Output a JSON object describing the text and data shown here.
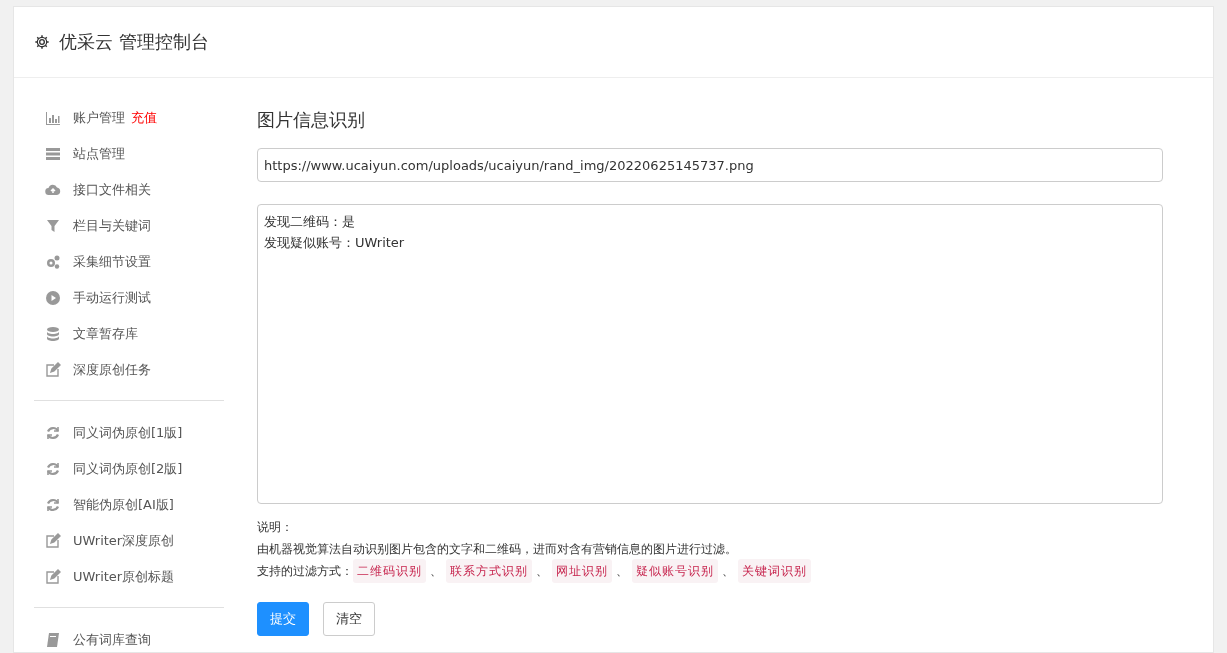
{
  "header": {
    "title": "优采云 管理控制台"
  },
  "sidebar": {
    "groups": [
      {
        "items": [
          {
            "label": "账户管理",
            "badge": "充值"
          },
          {
            "label": "站点管理"
          },
          {
            "label": "接口文件相关"
          },
          {
            "label": "栏目与关键词"
          },
          {
            "label": "采集细节设置"
          },
          {
            "label": "手动运行测试"
          },
          {
            "label": "文章暂存库"
          },
          {
            "label": "深度原创任务"
          }
        ]
      },
      {
        "items": [
          {
            "label": "同义词伪原创[1版]"
          },
          {
            "label": "同义词伪原创[2版]"
          },
          {
            "label": "智能伪原创[AI版]"
          },
          {
            "label": "UWriter深度原创"
          },
          {
            "label": "UWriter原创标题"
          }
        ]
      },
      {
        "items": [
          {
            "label": "公有词库查询"
          }
        ]
      }
    ]
  },
  "main": {
    "title": "图片信息识别",
    "url_field": {
      "value": "https://www.ucaiyun.com/uploads/ucaiyun/rand_img/20220625145737.png"
    },
    "result_field": {
      "lines": [
        "发现二维码：是",
        "发现疑似账号：UWriter"
      ]
    },
    "note_label": "说明：",
    "description": "由机器视觉算法自动识别图片包含的文字和二维码，进而对含有营销信息的图片进行过滤。",
    "methods_label": "支持的过滤方式：",
    "methods": [
      "二维码识别",
      "联系方式识别",
      "网址识别",
      "疑似账号识别",
      "关键词识别"
    ],
    "separator": "、",
    "buttons": [
      {
        "label": "提交",
        "kind": "primary"
      },
      {
        "label": "清空",
        "kind": "default"
      }
    ]
  }
}
